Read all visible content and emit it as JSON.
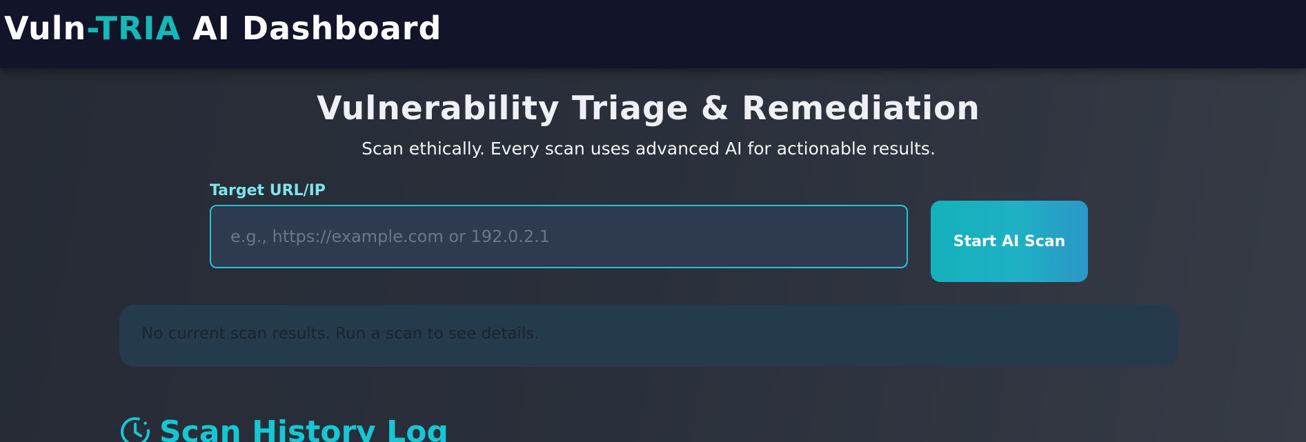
{
  "header": {
    "brand_prefix": "Vuln",
    "brand_accent": "-TRIA",
    "brand_suffix": " AI Dashboard"
  },
  "hero": {
    "title": "Vulnerability Triage & Remediation",
    "subtitle": "Scan ethically. Every scan uses advanced AI for actionable results."
  },
  "scan_form": {
    "label": "Target URL/IP",
    "input_value": "",
    "placeholder": "e.g., https://example.com or 192.0.2.1",
    "button_label": "Start AI Scan"
  },
  "results": {
    "message": "No current scan results. Run a scan to see details."
  },
  "history": {
    "title": "Scan History Log",
    "icon": "clock-icon"
  },
  "colors": {
    "accent": "#14b8b8",
    "header_bg": "#12152a",
    "label": "#7ee3ea",
    "input_border": "#22c5d8",
    "button_gradient_start": "#14b1bc",
    "button_gradient_end": "#2b97c8"
  }
}
